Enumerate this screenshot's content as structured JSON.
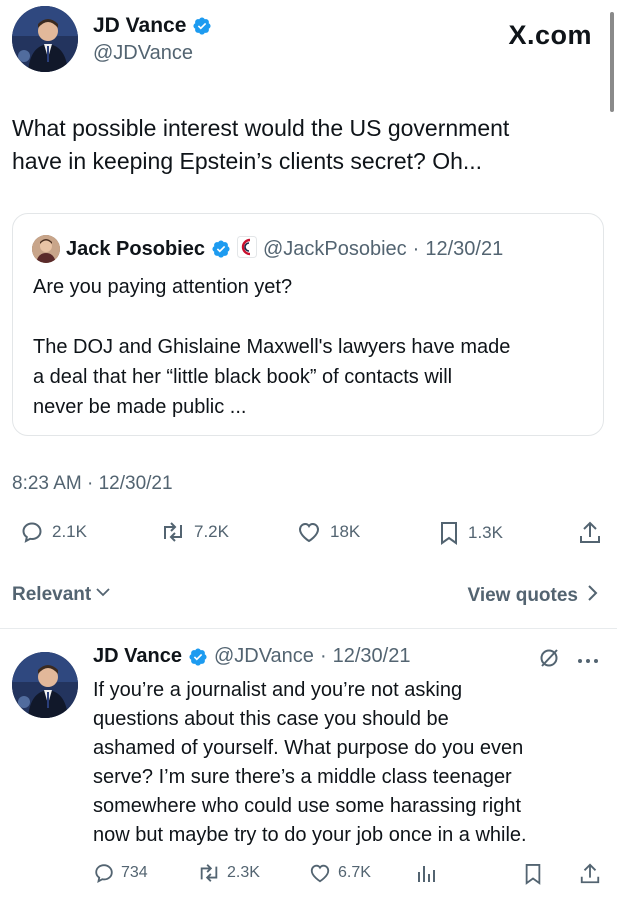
{
  "brand": {
    "label": "X.com"
  },
  "main_tweet": {
    "author": {
      "name": "JD Vance",
      "handle": "@JDVance",
      "verified": true
    },
    "text_lines": [
      "What possible interest would the US government",
      "have in keeping Epstein’s clients secret? Oh..."
    ],
    "timestamp": "8:23 AM · 12/30/21",
    "stats": {
      "replies": "2.1K",
      "reposts": "7.2K",
      "likes": "18K",
      "bookmarks": "1.3K"
    }
  },
  "quote": {
    "author": {
      "name": "Jack Posobiec",
      "handle": "@JackPosobiec",
      "date": "12/30/21",
      "separator": "·"
    },
    "paragraph1": "Are you paying attention yet?",
    "paragraph2_lines": [
      "The DOJ and Ghislaine Maxwell's lawyers have made",
      "a deal that her “little black book” of contacts will",
      "never be made public ..."
    ]
  },
  "sort": {
    "label": "Relevant"
  },
  "view_quotes": {
    "label": "View quotes"
  },
  "reply": {
    "author": {
      "name": "JD Vance",
      "handle": "@JDVance",
      "date": "12/30/21",
      "separator": "·"
    },
    "text_lines": [
      "If you’re a journalist and you’re not asking",
      "questions about this case you should be",
      "ashamed of yourself. What purpose do you even",
      "serve? I’m sure there’s a middle class teenager",
      "somewhere who could use some harassing right",
      "now but maybe try to do your job once in a while."
    ],
    "stats": {
      "replies": "734",
      "reposts": "2.3K",
      "likes": "6.7K"
    }
  },
  "colors": {
    "verified": "#1d9bf0",
    "muted": "#536471",
    "text": "#0f1419",
    "border": "#e3e6e8"
  },
  "icons": [
    "verified-badge-icon",
    "reply-icon",
    "repost-icon",
    "like-icon",
    "bookmark-icon",
    "share-icon",
    "chevron-down-icon",
    "chevron-right-icon",
    "grok-icon",
    "more-icon",
    "analytics-icon",
    "affiliate-badge-icon"
  ]
}
